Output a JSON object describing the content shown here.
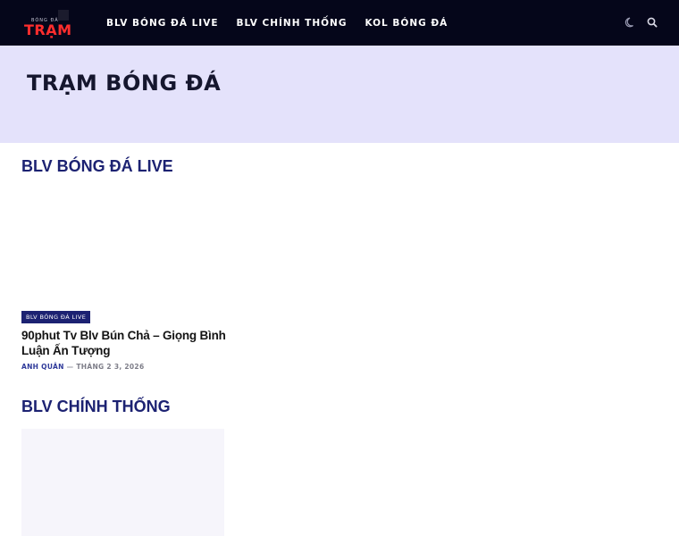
{
  "brand": {
    "small_text": "BÓNG ĐÁ",
    "name": "TRẠM"
  },
  "nav": [
    {
      "label": "BLV BÓNG ĐÁ LIVE"
    },
    {
      "label": "BLV CHÍNH THỐNG"
    },
    {
      "label": "KOL BÓNG ĐÁ"
    }
  ],
  "icons": {
    "theme": "moon-icon",
    "search": "search-icon"
  },
  "hero": {
    "title": "TRẠM BÓNG ĐÁ"
  },
  "sections": [
    {
      "title": "BLV BÓNG ĐÁ LIVE",
      "post": {
        "category": "BLV BÓNG ĐÁ LIVE",
        "title": "90phut Tv Blv Bún Chả – Giọng Bình Luận Ấn Tượng",
        "author": "ANH QUÂN",
        "separator": "—",
        "date": "THÁNG 2 3, 2026"
      }
    },
    {
      "title": "BLV CHÍNH THỐNG"
    }
  ],
  "colors": {
    "header_bg": "#05061a",
    "hero_bg": "#e4e2fb",
    "accent": "#1c2272",
    "logo_red": "#ff2d2d"
  }
}
